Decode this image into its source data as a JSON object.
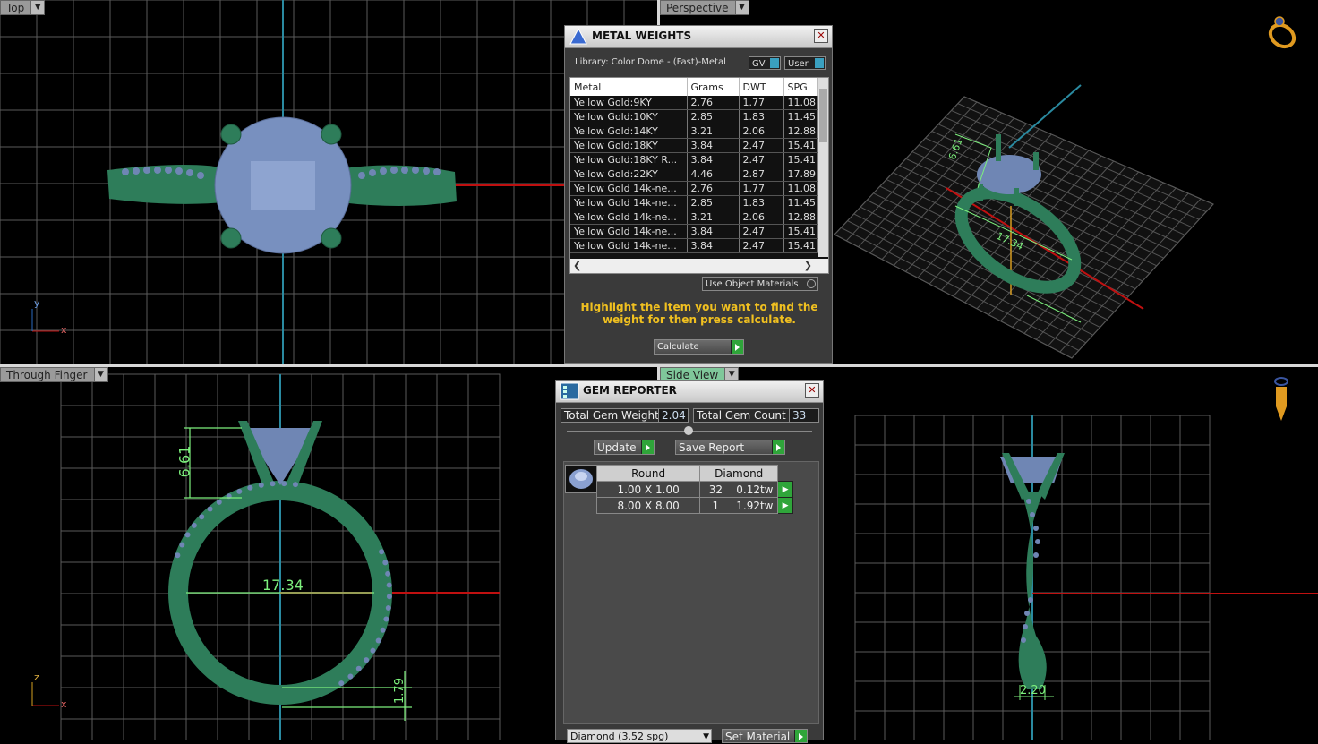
{
  "viewports": {
    "top": {
      "label": "Top",
      "axis_y": "y",
      "axis_x": "x"
    },
    "perspective": {
      "label": "Perspective",
      "dim_a": "6.61",
      "dim_b": "17.34"
    },
    "through_finger": {
      "label": "Through Finger",
      "dim_height": "6.61",
      "dim_width": "17.34",
      "dim_base": "1.79",
      "axis_z": "z",
      "axis_x": "x"
    },
    "side": {
      "label": "Side View",
      "dim_width": "2.20"
    }
  },
  "metal_weights": {
    "title": "METAL WEIGHTS",
    "library": "Library: Color Dome - (Fast)-Metal",
    "toggle_gv": "GV",
    "toggle_user": "User",
    "columns": [
      "Metal",
      "Grams",
      "DWT",
      "SPG"
    ],
    "rows": [
      [
        "Yellow Gold:9KY",
        "2.76",
        "1.77",
        "11.08"
      ],
      [
        "Yellow Gold:10KY",
        "2.85",
        "1.83",
        "11.45"
      ],
      [
        "Yellow Gold:14KY",
        "3.21",
        "2.06",
        "12.88"
      ],
      [
        "Yellow Gold:18KY",
        "3.84",
        "2.47",
        "15.41"
      ],
      [
        "Yellow Gold:18KY R...",
        "3.84",
        "2.47",
        "15.41"
      ],
      [
        "Yellow Gold:22KY",
        "4.46",
        "2.87",
        "17.89"
      ],
      [
        "Yellow Gold 14k-ne...",
        "2.76",
        "1.77",
        "11.08"
      ],
      [
        "Yellow Gold 14k-ne...",
        "2.85",
        "1.83",
        "11.45"
      ],
      [
        "Yellow Gold 14k-ne...",
        "3.21",
        "2.06",
        "12.88"
      ],
      [
        "Yellow Gold 14k-ne...",
        "3.84",
        "2.47",
        "15.41"
      ],
      [
        "Yellow Gold 14k-ne...",
        "3.84",
        "2.47",
        "15.41"
      ]
    ],
    "use_object_materials": "Use Object Materials",
    "hint": "Highlight the item you want to find the weight for then press calculate.",
    "calculate": "Calculate"
  },
  "gem_reporter": {
    "title": "GEM REPORTER",
    "total_weight_label": "Total Gem Weight",
    "total_weight": "2.04",
    "total_count_label": "Total Gem Count",
    "total_count": "33",
    "update": "Update",
    "save_report": "Save Report",
    "columns": [
      "Round",
      "Diamond"
    ],
    "rows": [
      [
        "1.00 X 1.00",
        "32",
        "0.12tw"
      ],
      [
        "8.00 X 8.00",
        "1",
        "1.92tw"
      ]
    ],
    "material_select": "Diamond    (3.52 spg)",
    "set_material": "Set Material"
  },
  "colors": {
    "grid": "#5a5a5a",
    "ring": "#2e7d5a",
    "gem": "#6f86b4",
    "dim": "#7df07d",
    "axis_red": "#c01010",
    "axis_blue": "#2a8aa0"
  }
}
